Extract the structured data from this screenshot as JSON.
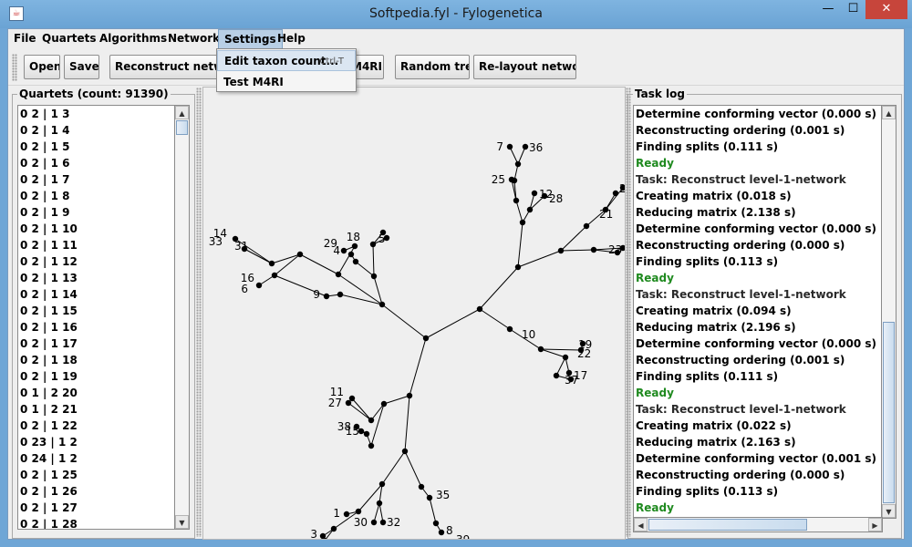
{
  "window": {
    "title": "Softpedia.fyl - Fylogenetica",
    "min": "—",
    "max": "☐",
    "close": "✕"
  },
  "menu": [
    "File",
    "Quartets",
    "Algorithms",
    "Network",
    "Settings",
    "Help"
  ],
  "settings_menu": [
    {
      "label": "Edit taxon count...",
      "accel": "Ctrl-T"
    },
    {
      "label": "Test M4RI",
      "accel": ""
    }
  ],
  "toolbar": {
    "open": "Open",
    "save": "Save",
    "reconstruct": "Reconstruct network",
    "m4ri": "M4RI)",
    "random_tree": "Random tree",
    "relayout": "Re-layout network"
  },
  "quartets": {
    "title": "Quartets (count: 91390)",
    "items": [
      "0 2 | 1 3",
      "0 2 | 1 4",
      "0 2 | 1 5",
      "0 2 | 1 6",
      "0 2 | 1 7",
      "0 2 | 1 8",
      "0 2 | 1 9",
      "0 2 | 1 10",
      "0 2 | 1 11",
      "0 2 | 1 12",
      "0 2 | 1 13",
      "0 2 | 1 14",
      "0 2 | 1 15",
      "0 2 | 1 16",
      "0 2 | 1 17",
      "0 2 | 1 18",
      "0 2 | 1 19",
      "0 1 | 2 20",
      "0 1 | 2 21",
      "0 2 | 1 22",
      "0 23 | 1 2",
      "0 24 | 1 2",
      "0 2 | 1 25",
      "0 2 | 1 26",
      "0 2 | 1 27",
      "0 2 | 1 28"
    ]
  },
  "task_log": {
    "title": "Task log",
    "lines": [
      {
        "text": "Determine conforming vector (0.000 s)",
        "kind": "normal"
      },
      {
        "text": "Reconstructing ordering (0.001 s)",
        "kind": "normal"
      },
      {
        "text": "Finding splits (0.111 s)",
        "kind": "normal"
      },
      {
        "text": "Ready",
        "kind": "ready"
      },
      {
        "text": "Task: Reconstruct level-1-network",
        "kind": "task"
      },
      {
        "text": "Creating matrix (0.018 s)",
        "kind": "normal"
      },
      {
        "text": "Reducing matrix (2.138 s)",
        "kind": "normal"
      },
      {
        "text": "Determine conforming vector (0.000 s)",
        "kind": "normal"
      },
      {
        "text": "Reconstructing ordering (0.000 s)",
        "kind": "normal"
      },
      {
        "text": "Finding splits (0.113 s)",
        "kind": "normal"
      },
      {
        "text": "Ready",
        "kind": "ready"
      },
      {
        "text": "Task: Reconstruct level-1-network",
        "kind": "task"
      },
      {
        "text": "Creating matrix (0.094 s)",
        "kind": "normal"
      },
      {
        "text": "Reducing matrix (2.196 s)",
        "kind": "normal"
      },
      {
        "text": "Determine conforming vector (0.000 s)",
        "kind": "normal"
      },
      {
        "text": "Reconstructing ordering (0.001 s)",
        "kind": "normal"
      },
      {
        "text": "Finding splits (0.111 s)",
        "kind": "normal"
      },
      {
        "text": "Ready",
        "kind": "ready"
      },
      {
        "text": "Task: Reconstruct level-1-network",
        "kind": "task"
      },
      {
        "text": "Creating matrix (0.022 s)",
        "kind": "normal"
      },
      {
        "text": "Reducing matrix (2.163 s)",
        "kind": "normal"
      },
      {
        "text": "Determine conforming vector (0.001 s)",
        "kind": "normal"
      },
      {
        "text": "Reconstructing ordering (0.000 s)",
        "kind": "normal"
      },
      {
        "text": "Finding splits (0.113 s)",
        "kind": "normal"
      },
      {
        "text": "Ready",
        "kind": "ready"
      }
    ]
  },
  "network": {
    "leaf_labels": [
      "7",
      "36",
      "25",
      "12",
      "28",
      "2",
      "21",
      "23",
      "14",
      "33",
      "31",
      "29",
      "18",
      "5",
      "4",
      "16",
      "6",
      "9",
      "10",
      "19",
      "22",
      "17",
      "37",
      "11",
      "27",
      "38",
      "15",
      "35",
      "1",
      "30",
      "32",
      "8",
      "3",
      "26",
      "39"
    ]
  },
  "colors": {
    "ready": "#1f8a1f",
    "menu_highlight": "#b8cfe5",
    "close_button": "#c7453b"
  }
}
